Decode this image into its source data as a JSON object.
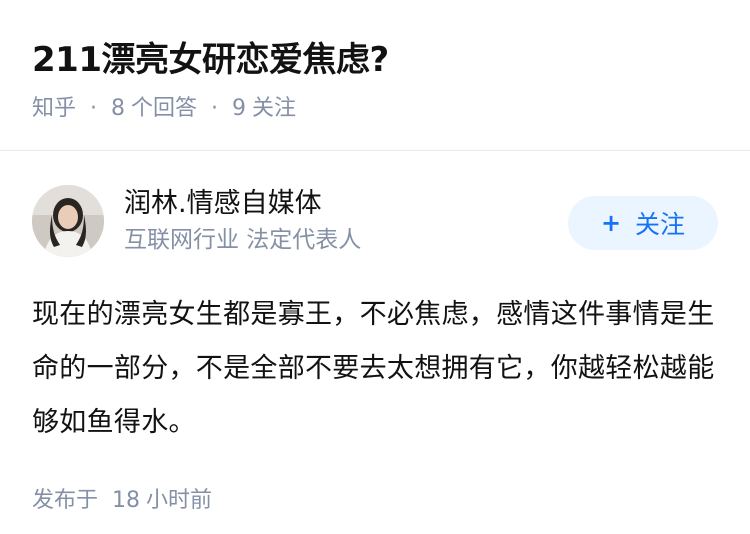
{
  "question": {
    "title": "211漂亮女研恋爱焦虑?",
    "source": "知乎",
    "answer_count": "8",
    "answer_unit": "个回答",
    "follower_count": "9",
    "follower_unit": "关注"
  },
  "answer": {
    "author_name": "润林.情感自媒体",
    "author_desc": "互联网行业 法定代表人",
    "follow_plus": "+",
    "follow_label": "关注",
    "content": "现在的漂亮女生都是寡王，不必焦虑，感情这件事情是生命的一部分，不是全部不要去太想拥有它，你越轻松越能够如鱼得水。",
    "published_prefix": "发布于",
    "published_num": "18",
    "published_unit": "小时前"
  },
  "colors": {
    "meta_gray": "#8590a6",
    "accent_blue": "#1772f6",
    "follow_bg": "#ebf5ff"
  }
}
